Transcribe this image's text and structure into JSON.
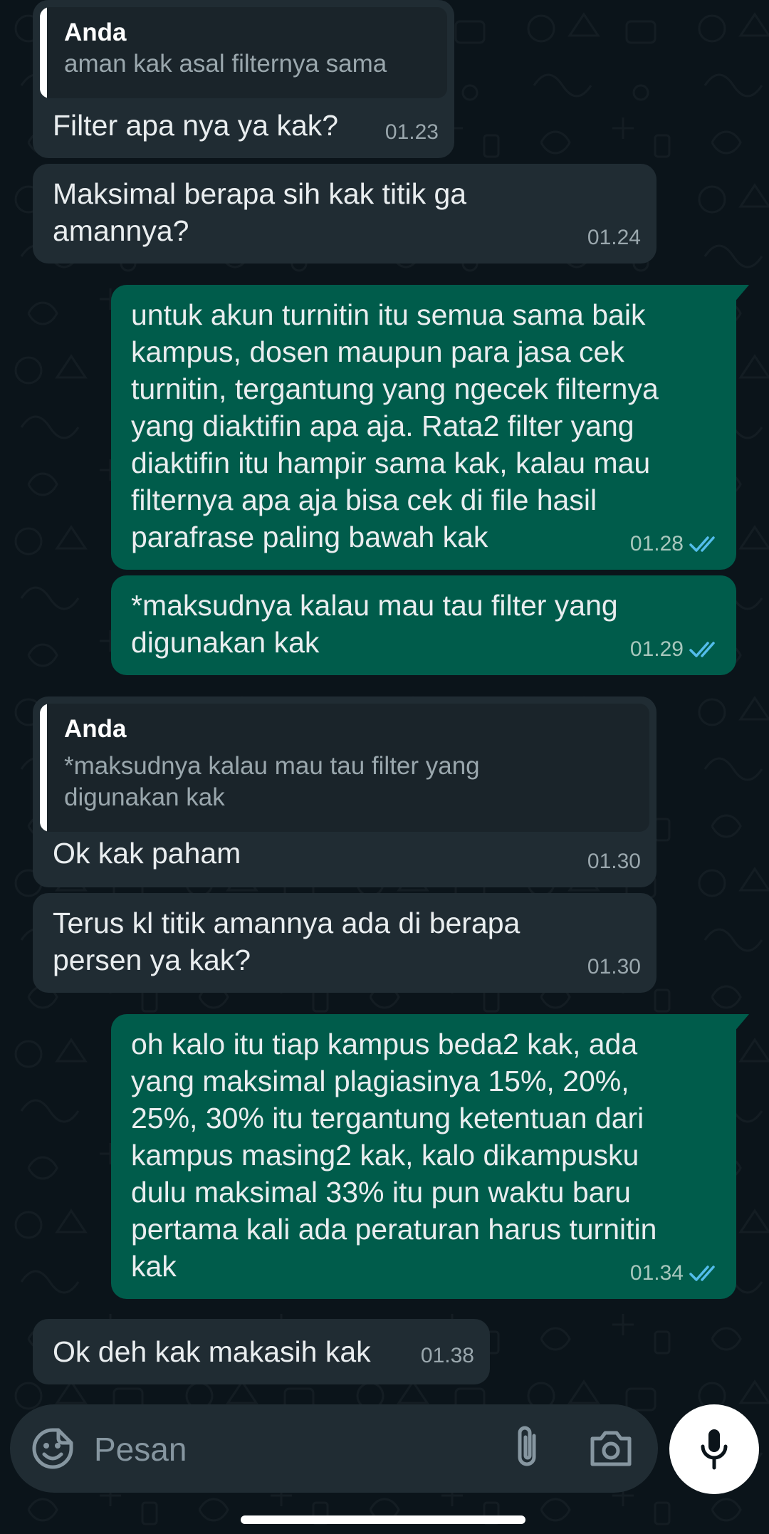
{
  "messages": [
    {
      "id": "m1",
      "direction": "in",
      "quote": {
        "author": "Anda",
        "text": "aman kak asal filternya sama"
      },
      "text": "Filter apa nya ya kak?",
      "time": "01.23"
    },
    {
      "id": "m2",
      "direction": "in",
      "text": "Maksimal berapa sih kak titik ga\namannya?",
      "time": "01.24"
    },
    {
      "id": "m3",
      "direction": "out",
      "text": "untuk akun turnitin itu semua sama baik\nkampus, dosen maupun para jasa cek\nturnitin, tergantung yang ngecek filternya\nyang diaktifin apa aja. Rata2 filter yang\ndiaktifin itu hampir sama kak, kalau mau\nfilternya apa aja bisa cek di file hasil\nparafrase paling bawah kak",
      "time": "01.28",
      "status": "read"
    },
    {
      "id": "m4",
      "direction": "out",
      "text": "*maksudnya kalau mau tau filter yang\ndigunakan kak",
      "time": "01.29",
      "status": "read"
    },
    {
      "id": "m5",
      "direction": "in",
      "quote": {
        "author": "Anda",
        "text": "*maksudnya kalau mau tau filter yang\ndigunakan kak"
      },
      "text": "Ok kak paham",
      "time": "01.30"
    },
    {
      "id": "m6",
      "direction": "in",
      "text": "Terus kl titik amannya ada di berapa\npersen ya kak?",
      "time": "01.30"
    },
    {
      "id": "m7",
      "direction": "out",
      "text": "oh kalo itu tiap kampus beda2 kak, ada\nyang maksimal plagiasinya 15%, 20%,\n25%, 30% itu tergantung ketentuan dari\nkampus masing2 kak, kalo dikampusku\ndulu maksimal 33% itu pun waktu baru\npertama kali ada peraturan harus turnitin\nkak",
      "time": "01.34",
      "status": "read"
    },
    {
      "id": "m8",
      "direction": "in",
      "text": "Ok deh kak makasih kak",
      "time": "01.38"
    }
  ],
  "composer": {
    "placeholder": "Pesan",
    "icons": [
      "emoji-sticker-icon",
      "attach-icon",
      "camera-icon",
      "mic-icon"
    ]
  },
  "colors": {
    "background": "#0b141a",
    "incoming_bubble": "#202c33",
    "outgoing_bubble": "#005c4b",
    "read_ticks": "#53bdeb"
  }
}
